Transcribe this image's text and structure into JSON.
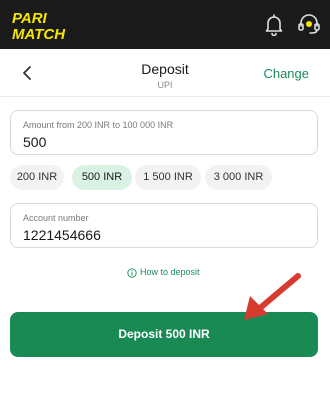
{
  "brand": {
    "logo_text": [
      "PARI",
      "MATCH"
    ],
    "logo_color": "#f5e600"
  },
  "topbar": {
    "icons": [
      "bell-icon",
      "support-headset-icon"
    ]
  },
  "header": {
    "title": "Deposit",
    "subtitle": "UPI",
    "change_label": "Change"
  },
  "amount": {
    "label": "Amount from 200 INR to 100 000 INR",
    "value": "500"
  },
  "presets": [
    {
      "label": "200 INR",
      "selected": false
    },
    {
      "label": "500 INR",
      "selected": true
    },
    {
      "label": "1 500 INR",
      "selected": false
    },
    {
      "label": "3 000 INR",
      "selected": false
    }
  ],
  "account": {
    "label": "Account number",
    "value": "1221454666"
  },
  "help": {
    "label": "How to deposit"
  },
  "submit": {
    "label": "Deposit 500 INR"
  },
  "colors": {
    "accent": "#1a8a55",
    "chip_selected": "#d9f2e3",
    "annotation_arrow": "#d63b2f",
    "topbar": "#1a1a1a"
  }
}
